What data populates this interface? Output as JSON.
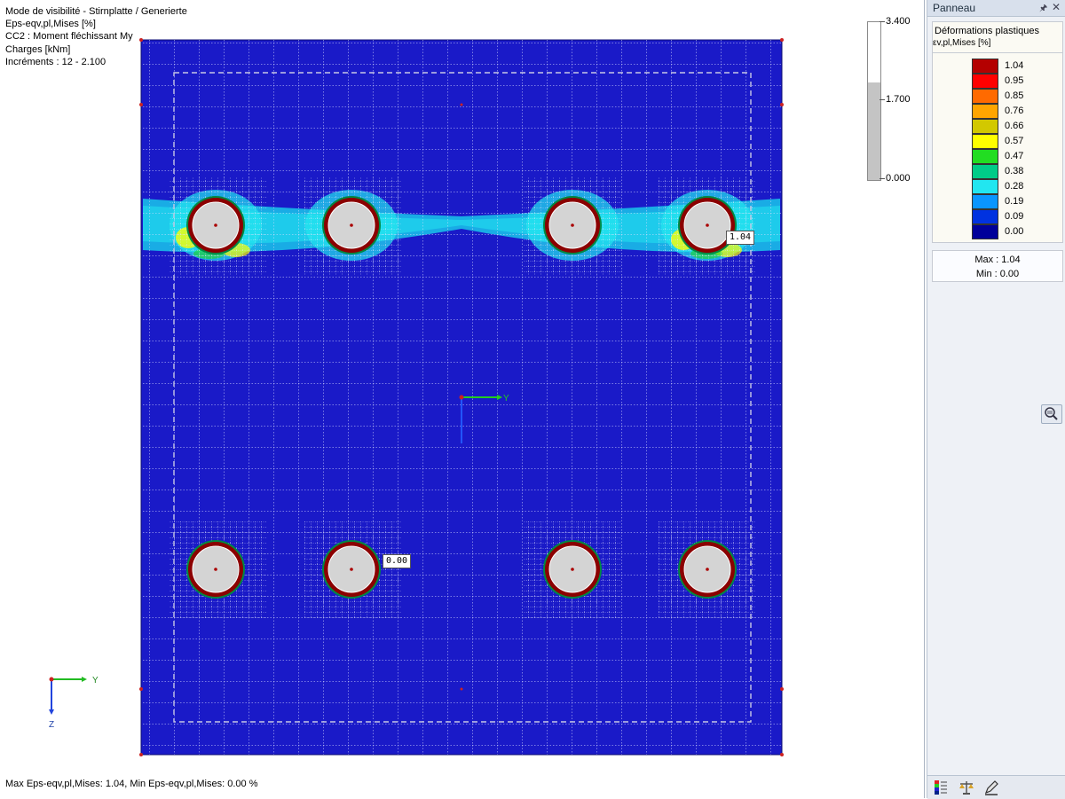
{
  "viewport": {
    "info_lines": [
      "Mode de visibilité       - Stirnplatte / Generierte",
      " Eps-eqv,pl,Mises [%]",
      "CC2 : Moment fléchissant My",
      "Charges [kNm]",
      "Incréments : 12 - 2.100"
    ],
    "scale": {
      "top": "3.400",
      "mid": "1.700",
      "bottom": "0.000",
      "fill_fraction": 0.62
    },
    "max_label": "1.04",
    "min_label": "0.00",
    "center_axis_y": "Y",
    "corner_axis_y": "Y",
    "corner_axis_z": "Z",
    "status_text": "Max Eps-eqv,pl,Mises: 1.04, Min Eps-eqv,pl,Mises: 0.00 %"
  },
  "panel": {
    "title": "Panneau",
    "pin_icon": "pin-icon",
    "close_icon": "close-icon",
    "legend_title": "Déformations plastiques",
    "legend_subtitle": "εv,pl,Mises [%]",
    "legend_rows": [
      {
        "value": "1.04",
        "color": "#b40000"
      },
      {
        "value": "0.95",
        "color": "#ff0000"
      },
      {
        "value": "0.85",
        "color": "#ff6a00"
      },
      {
        "value": "0.76",
        "color": "#ffa500"
      },
      {
        "value": "0.66",
        "color": "#d2c800"
      },
      {
        "value": "0.57",
        "color": "#ffff00"
      },
      {
        "value": "0.47",
        "color": "#22dd22"
      },
      {
        "value": "0.38",
        "color": "#00cc88"
      },
      {
        "value": "0.28",
        "color": "#22e6f0"
      },
      {
        "value": "0.19",
        "color": "#0a96ff"
      },
      {
        "value": "0.09",
        "color": "#0032e0"
      },
      {
        "value": "0.00",
        "color": "#00009a"
      }
    ],
    "max_text": "Max  :  1.04",
    "min_text": "Min  :  0.00"
  },
  "colors": {
    "plate": "#1a1ac8",
    "mesh": "#d8dcff",
    "hole_ring": "#8b0000",
    "hole_fill": "#d4d4d4",
    "band": "#19bde8"
  }
}
